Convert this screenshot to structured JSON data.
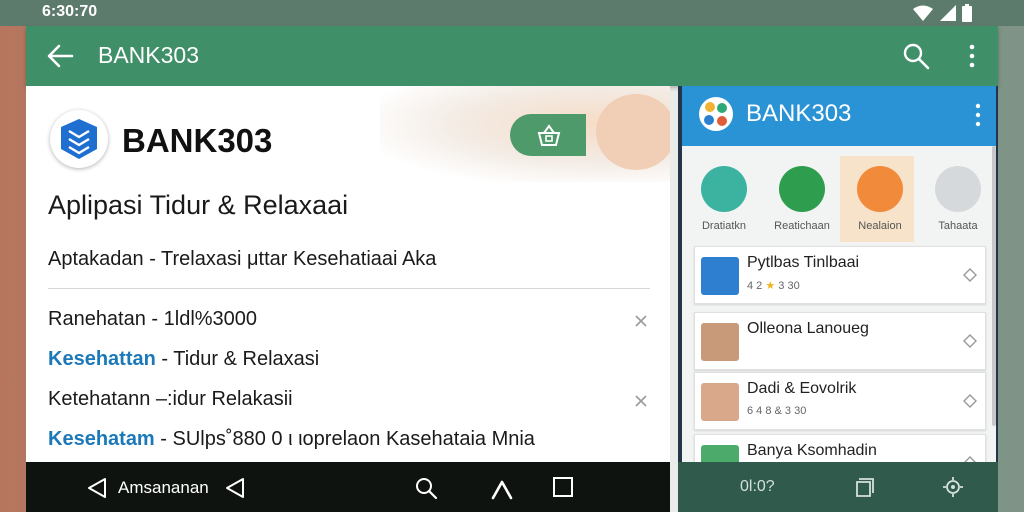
{
  "status": {
    "time": "6:30:70"
  },
  "appbar": {
    "title": "BANK303"
  },
  "left": {
    "brand": "BANK303",
    "app_title": "Aplipasi Tidur & Relaxaai",
    "app_subtitle": "Aptakadan - Trelaxasi μttar Kesehatiaai Aka",
    "rows": [
      {
        "accent": "",
        "text": "Ranehatan  -  1ldl%3000"
      },
      {
        "accent": "Kesehattan",
        "text": " - Tidur & Relaxasi"
      },
      {
        "accent": "",
        "text": "Ketehatann  –:idur Relakasii"
      },
      {
        "accent": "Kesehatam",
        "text": " - SUlps˚880 0   ι ιoprelaon Kasehataia Mnia"
      }
    ]
  },
  "navbar": {
    "label": "Amsananan"
  },
  "right": {
    "title": "BANK303",
    "categories": [
      {
        "label": "Dratiatkn",
        "color": "#3bb3a0"
      },
      {
        "label": "Reatichaan",
        "color": "#2e9d4e"
      },
      {
        "label": "Nealaion",
        "color": "#f18a3a"
      },
      {
        "label": "Tahaata",
        "color": "#d5d9dc"
      }
    ],
    "cards": [
      {
        "title": "Pytlbas Tinlbaai",
        "meta_pre": "4 2 ",
        "meta_post": " 3 30"
      },
      {
        "title": "Olleona Lanoueg",
        "meta_pre": "",
        "meta_post": ""
      },
      {
        "title": "Dadi & Eovolrik",
        "meta_pre": "",
        "meta_post": "6 4 8 & 3 30"
      },
      {
        "title": "Banya Ksomhadin",
        "meta_pre": "",
        "meta_post": ""
      }
    ],
    "nav_label": "0l:0?"
  },
  "colors": {
    "appbar": "#3f8f69",
    "right_appbar": "#2a93d5",
    "accent_text": "#1c79b8",
    "navbar": "#0f1310"
  }
}
